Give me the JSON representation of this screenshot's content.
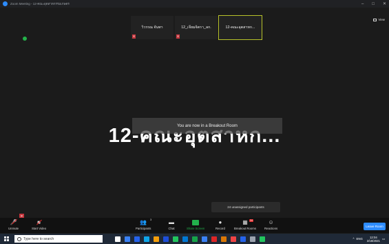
{
  "window": {
    "title": "Zoom Meeting - 12-คณะอุตสาหกรรมเกษตร",
    "controls": [
      "–",
      "□",
      "✕"
    ]
  },
  "view": {
    "label": "View"
  },
  "tiles": [
    {
      "name": "วิวรรณ  จันทา",
      "active": false
    },
    {
      "name": "12_เจียมจิตรา_ลก.",
      "active": false
    },
    {
      "name": "12-คณะอุตสาหก...",
      "active": true
    }
  ],
  "main": {
    "active_speaker_name": "12-คณะอุตสาหก...",
    "breakout_notice": "You are now in a Breakout Room",
    "unassigned": "24 unassigned participants"
  },
  "toolbar": {
    "unmute": "Unmute",
    "start_video": "Start Video",
    "participants": "Participants",
    "participants_count": "3",
    "chat": "Chat",
    "share_screen": "Share Screen",
    "record": "Record",
    "breakout_rooms": "Breakout Rooms",
    "breakout_badge": "24",
    "reactions": "Reactions",
    "leave": "Leave Room"
  },
  "taskbar": {
    "search_placeholder": "Type here to search",
    "language": "ENG",
    "time": "12:04",
    "date": "2/18/2021",
    "icon_colors": [
      "#ffffff",
      "#3b82f6",
      "#2563eb",
      "#0ea5e9",
      "#f59e0b",
      "#1d4ed8",
      "#22c55e",
      "#0078d4",
      "#16a34a",
      "#3b82f6",
      "#dc2626",
      "#d97706",
      "#ef4444",
      "#2563eb",
      "#9ca3af",
      "#22c55e"
    ]
  }
}
